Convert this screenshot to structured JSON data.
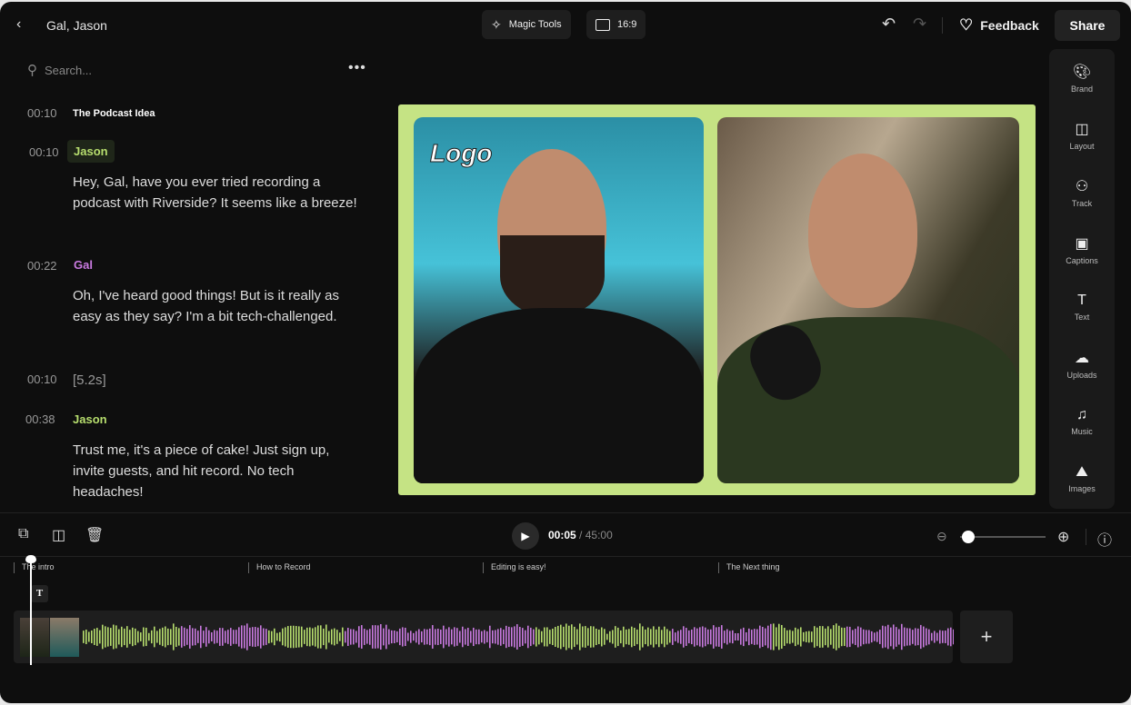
{
  "header": {
    "title": "Gal, Jason",
    "magic_tools": "Magic Tools",
    "aspect": "16:9",
    "feedback": "Feedback",
    "share": "Share"
  },
  "search": {
    "placeholder": "Search..."
  },
  "transcript": [
    {
      "type": "chapter",
      "time": "00:10",
      "label": "The Podcast Idea"
    },
    {
      "type": "speaker",
      "time": "00:10",
      "speaker": "Jason",
      "text": "Hey, Gal, have you ever tried recording a podcast with Riverside? It seems like a breeze!"
    },
    {
      "type": "speaker",
      "time": "00:22",
      "speaker": "Gal",
      "text": "Oh, I've heard good things! But is it really as easy as they say? I'm a bit tech-challenged."
    },
    {
      "type": "pause",
      "time": "00:10",
      "label": "[5.2s]"
    },
    {
      "type": "speaker",
      "time": "00:38",
      "speaker": "Jason",
      "text": "Trust me, it's a piece of cake! Just sign up, invite guests, and hit record. No tech headaches!"
    }
  ],
  "colors": {
    "jason": "#b7de6e",
    "gal": "#c97ae0",
    "frame": "#c5e384"
  },
  "video": {
    "logo": "Logo"
  },
  "rail": [
    {
      "label": "Brand",
      "icon": "palette-icon"
    },
    {
      "label": "Layout",
      "icon": "layout-icon"
    },
    {
      "label": "Track",
      "icon": "users-icon"
    },
    {
      "label": "Captions",
      "icon": "captions-icon"
    },
    {
      "label": "Text",
      "icon": "text-icon"
    },
    {
      "label": "Uploads",
      "icon": "upload-icon"
    },
    {
      "label": "Music",
      "icon": "music-icon"
    },
    {
      "label": "Images",
      "icon": "image-icon"
    }
  ],
  "player": {
    "current": "00:05",
    "total": "/ 45:00",
    "zoom_level": 0.1
  },
  "timeline": {
    "chapters": [
      "The intro",
      "How to Record",
      "Editing is easy!",
      "The Next thing"
    ],
    "text_badge": "T"
  }
}
